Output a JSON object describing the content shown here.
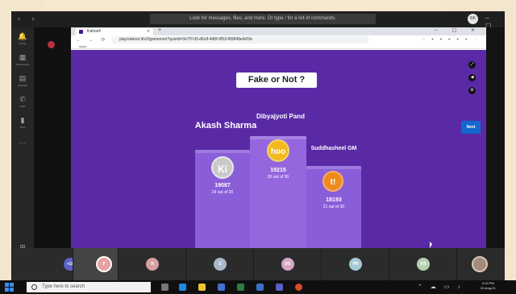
{
  "teams": {
    "search_placeholder": "Look for messages, files, and more. Or type / for a list of commands.",
    "profile_initials": "RK",
    "window_controls": "– ▢ ✕",
    "rail": [
      {
        "icon": "activity-icon",
        "glyph": "🔔",
        "label": "Activity"
      },
      {
        "icon": "teams-icon",
        "glyph": "▦",
        "label": "Assignments"
      },
      {
        "icon": "calendar-icon",
        "glyph": "▤",
        "label": "Calendar"
      },
      {
        "icon": "calls-icon",
        "glyph": "✆",
        "label": "Calls"
      },
      {
        "icon": "files-icon",
        "glyph": "▮",
        "label": "Files"
      },
      {
        "icon": "more-icon",
        "glyph": "···",
        "label": ""
      },
      {
        "icon": "apps-icon",
        "glyph": "⊞",
        "label": "Apps"
      },
      {
        "icon": "help-icon",
        "glyph": "?",
        "label": "Help"
      }
    ]
  },
  "browser": {
    "tab_title": "Kahoot!",
    "url": "play.kahoot.it/v2/gameover?quizId=3e7f7cf3-d6c8-4d0f-9f53-f65848e4d1fe",
    "bookmark_label": "Apps"
  },
  "kahoot": {
    "question_title": "Fake or Not ?",
    "next_label": "Next",
    "podium": [
      {
        "rank": 2,
        "name": "Akash Sharma",
        "badge": "Ki",
        "badge_color": "#c9c9c9",
        "score": "19087",
        "detail": "24 out of 30"
      },
      {
        "rank": 1,
        "name": "Dibyajyoti Pand",
        "badge": "hoo",
        "badge_color": "#f1b91b",
        "score": "19215",
        "detail": "20 out of 30"
      },
      {
        "rank": 3,
        "name": "Suddhasheel GM",
        "badge": "t!",
        "badge_color": "#ef8a1f",
        "score": "18193",
        "detail": "21 out of 30"
      }
    ]
  },
  "participants": [
    {
      "initials": "+18",
      "color": "#5b5fc7"
    },
    {
      "initials": "P",
      "color": "#e9a0a0"
    },
    {
      "initials": "R",
      "color": "#d6a0a0"
    },
    {
      "initials": "S",
      "color": "#a8b7c9"
    },
    {
      "initials": "DG",
      "color": "#d4a6c0"
    },
    {
      "initials": "PR",
      "color": "#a7c9d6"
    },
    {
      "initials": "KS",
      "color": "#b6d1b2"
    },
    {
      "initials": "",
      "color": "#a58c7a"
    }
  ],
  "taskbar": {
    "search_placeholder": "Type here to search",
    "time": "4:10 PM",
    "date": "20-Aug-21"
  }
}
